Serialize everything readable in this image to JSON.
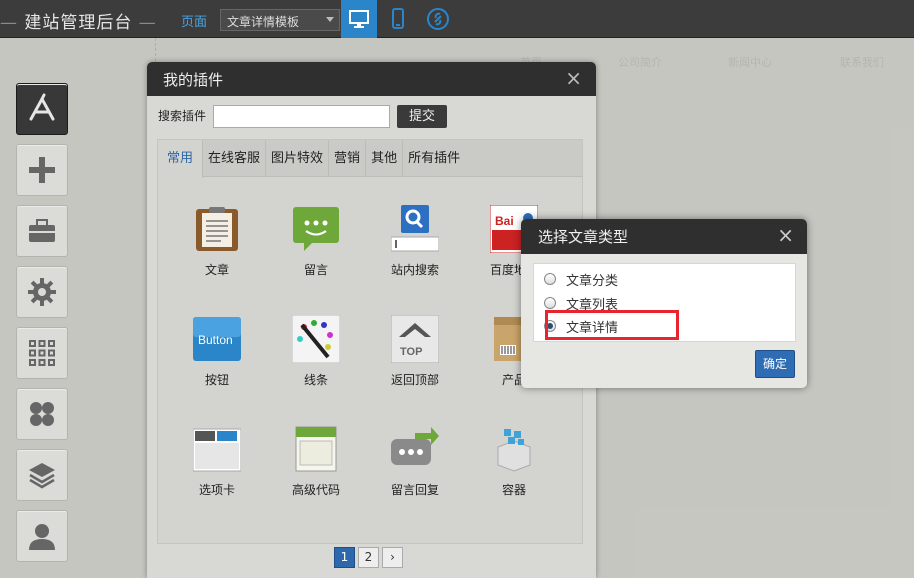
{
  "header": {
    "brand": "建站管理后台",
    "page_label": "页面",
    "page_select": "文章详情模板",
    "device_icons": [
      "desktop-icon",
      "mobile-icon",
      "link-icon"
    ]
  },
  "site_nav": [
    "首页",
    "公司简介",
    "新闻中心",
    "联系我们"
  ],
  "sidebar": {
    "items": [
      {
        "name": "app-store-icon",
        "active": true
      },
      {
        "name": "plus-icon",
        "active": false
      },
      {
        "name": "toolbox-icon",
        "active": false
      },
      {
        "name": "gear-icon",
        "active": false
      },
      {
        "name": "grid-icon",
        "active": false
      },
      {
        "name": "clover-icon",
        "active": false
      },
      {
        "name": "layers-icon",
        "active": false
      },
      {
        "name": "user-icon",
        "active": false
      }
    ]
  },
  "plugin_dialog": {
    "title": "我的插件",
    "close": "×",
    "search_label": "搜索插件",
    "search_value": "",
    "submit_label": "提交",
    "tabs": [
      "常用",
      "在线客服",
      "图片特效",
      "营销",
      "其他",
      "所有插件"
    ],
    "active_tab": 0,
    "plugins": [
      "文章",
      "留言",
      "站内搜索",
      "百度地图",
      "按钮",
      "线条",
      "返回顶部",
      "产品",
      "选项卡",
      "高级代码",
      "留言回复",
      "容器"
    ],
    "pager": [
      "1",
      "2",
      "›"
    ]
  },
  "type_dialog": {
    "title": "选择文章类型",
    "close": "×",
    "options": [
      "文章分类",
      "文章列表",
      "文章详情"
    ],
    "selected": 2,
    "ok_label": "确定"
  },
  "colors": {
    "accent": "#2e6db3",
    "highlight": "#e8252f",
    "topbar": "#3c3c3c"
  }
}
